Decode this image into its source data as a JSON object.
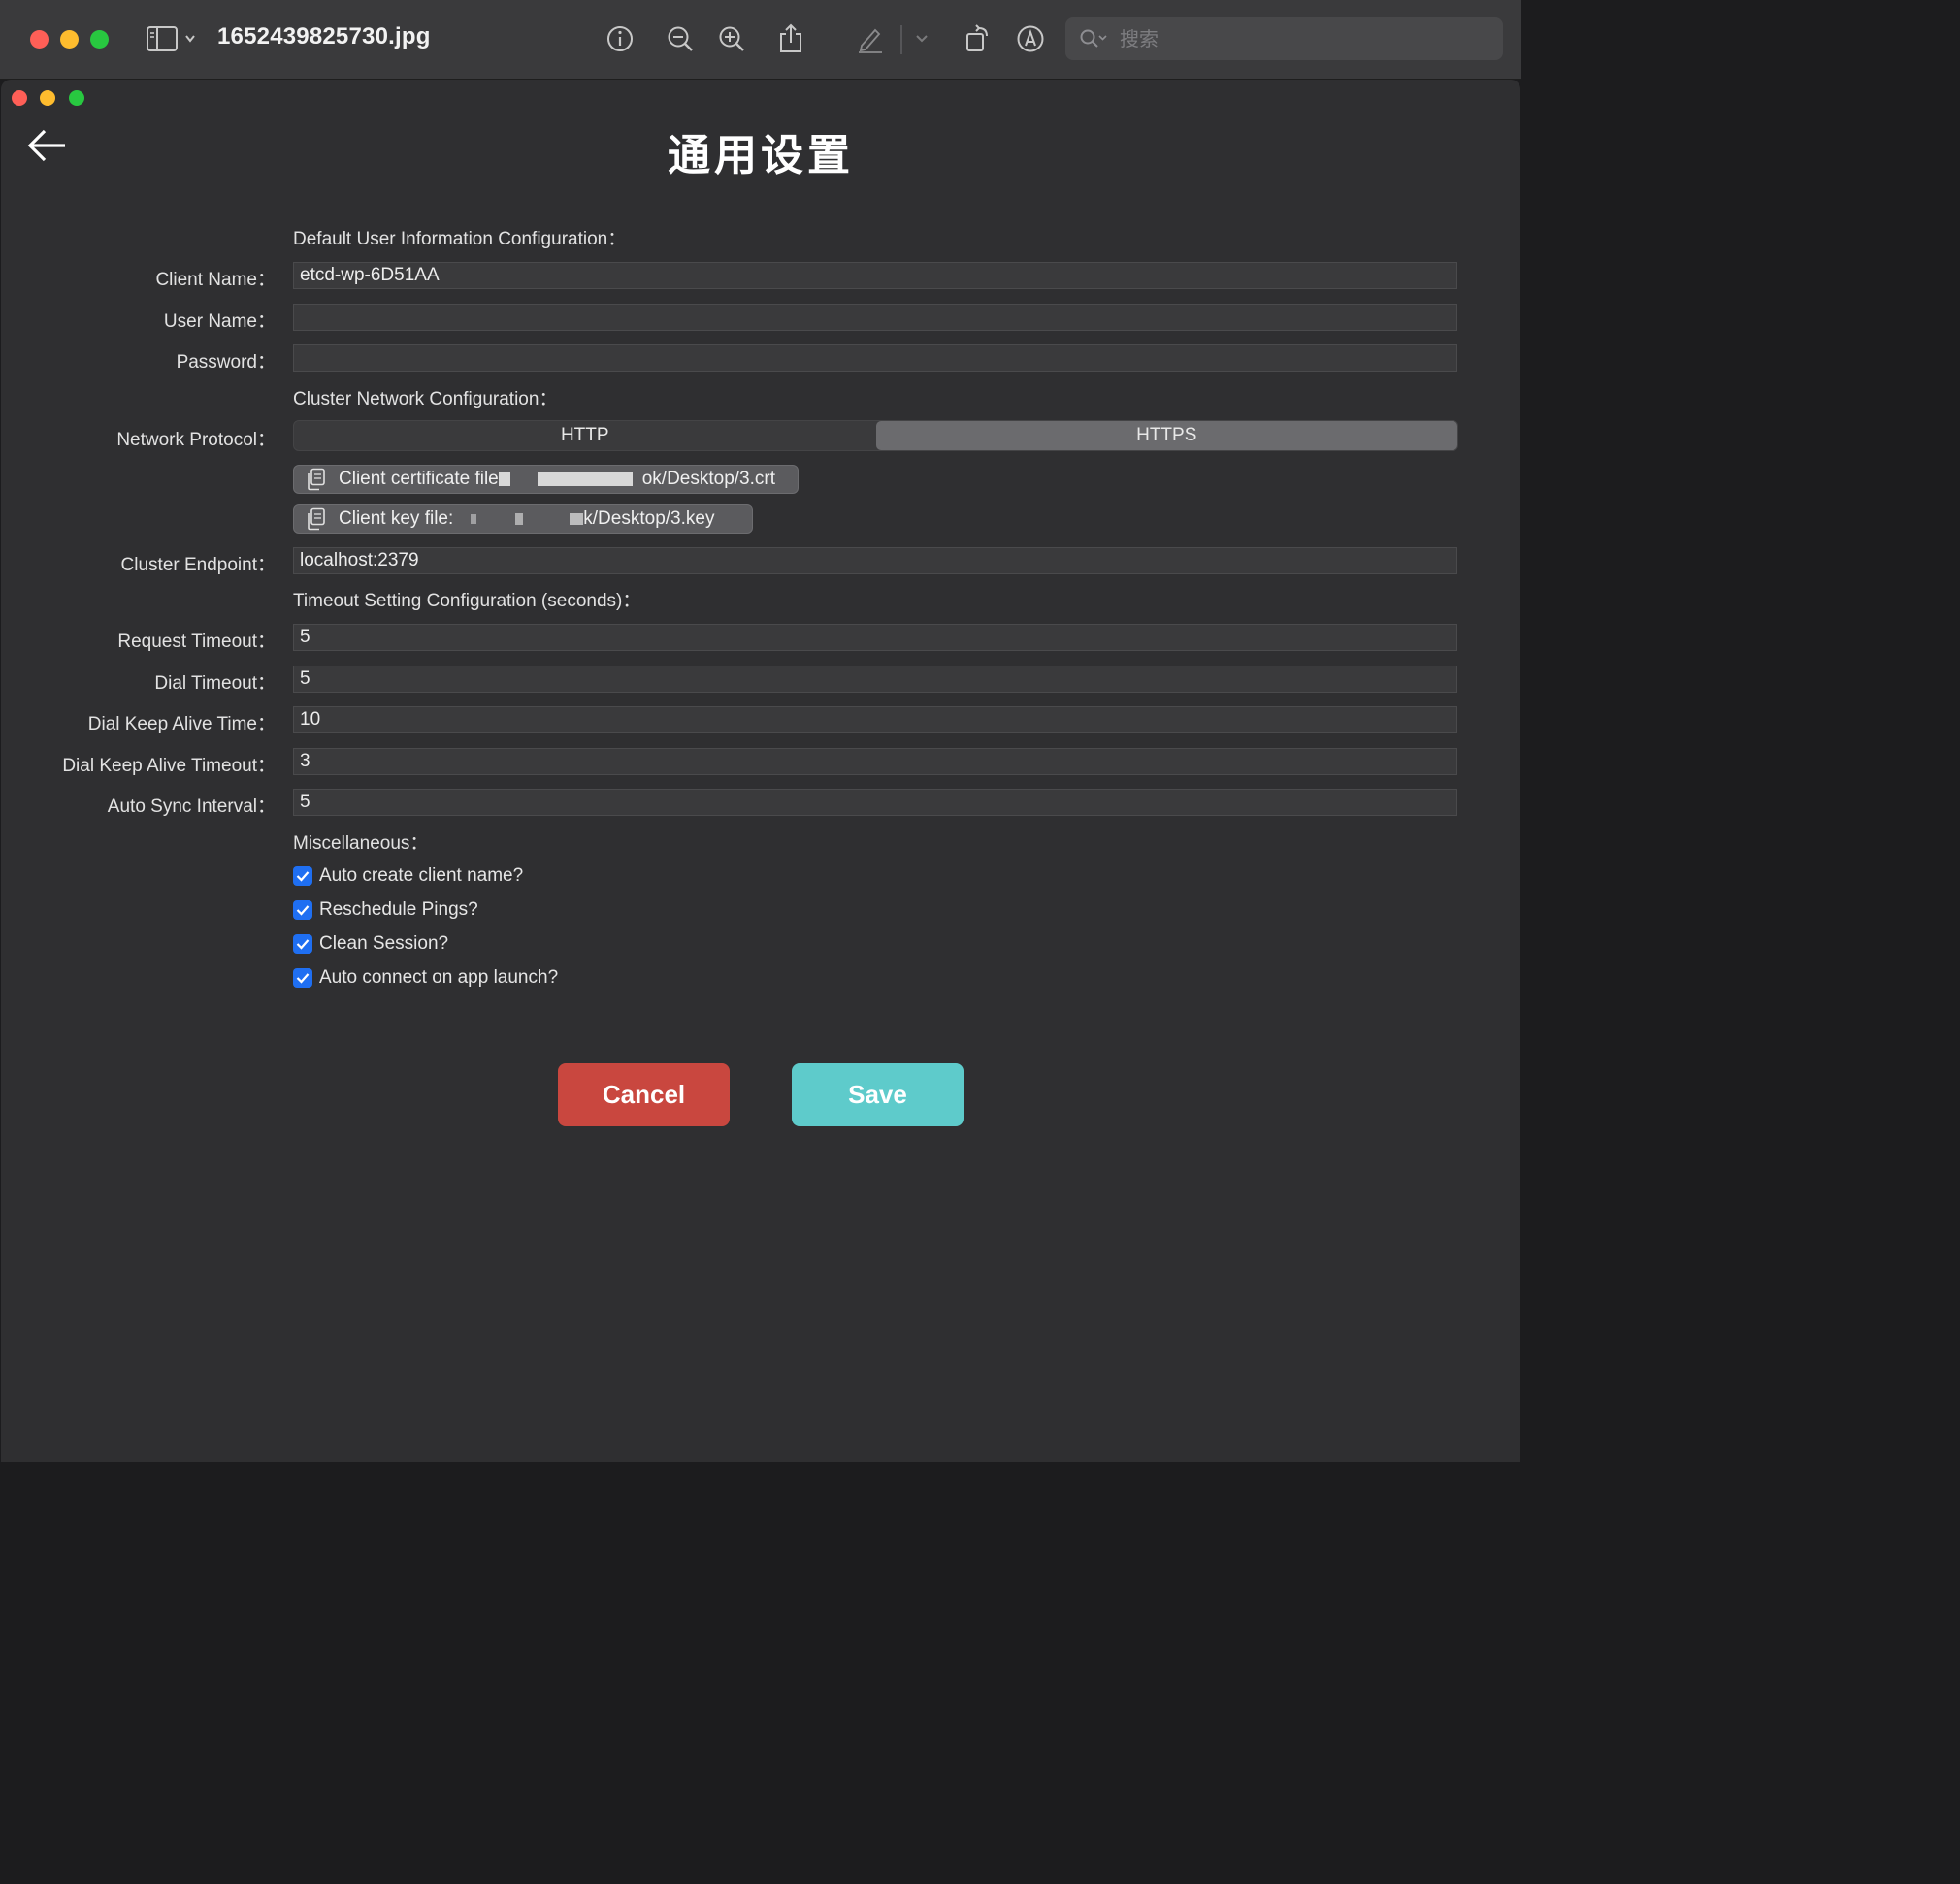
{
  "viewer": {
    "filename": "1652439825730.jpg",
    "search_placeholder": "搜索"
  },
  "settings": {
    "title": "通用设置",
    "sections": {
      "user_info": "Default User Information Configuration：",
      "network": "Cluster Network Configuration：",
      "timeout": "Timeout Setting Configuration (seconds)：",
      "misc": "Miscellaneous："
    },
    "labels": {
      "client_name": "Client Name：",
      "user_name": "User Name：",
      "password": "Password：",
      "network_protocol": "Network Protocol：",
      "cluster_endpoint": "Cluster Endpoint：",
      "request_timeout": "Request Timeout：",
      "dial_timeout": "Dial Timeout：",
      "dial_keep_alive_time": "Dial Keep Alive Time：",
      "dial_keep_alive_timeout": "Dial Keep Alive Timeout：",
      "auto_sync_interval": "Auto Sync Interval："
    },
    "values": {
      "client_name": "etcd-wp-6D51AA",
      "user_name": "",
      "password": "",
      "cluster_endpoint": "localhost:2379",
      "request_timeout": "5",
      "dial_timeout": "5",
      "dial_keep_alive_time": "10",
      "dial_keep_alive_timeout": "3",
      "auto_sync_interval": "5"
    },
    "protocol": {
      "options": [
        "HTTP",
        "HTTPS"
      ],
      "selected": "HTTPS"
    },
    "files": {
      "cert_label": "Client certificate file",
      "cert_path_tail": "ok/Desktop/3.crt",
      "key_label": "Client key file:",
      "key_path_tail": "k/Desktop/3.key"
    },
    "checkboxes": [
      {
        "label": "Auto create client name?",
        "checked": true
      },
      {
        "label": "Reschedule Pings?",
        "checked": true
      },
      {
        "label": "Clean Session?",
        "checked": true
      },
      {
        "label": "Auto connect on app launch?",
        "checked": true
      }
    ],
    "buttons": {
      "cancel": "Cancel",
      "save": "Save"
    }
  }
}
